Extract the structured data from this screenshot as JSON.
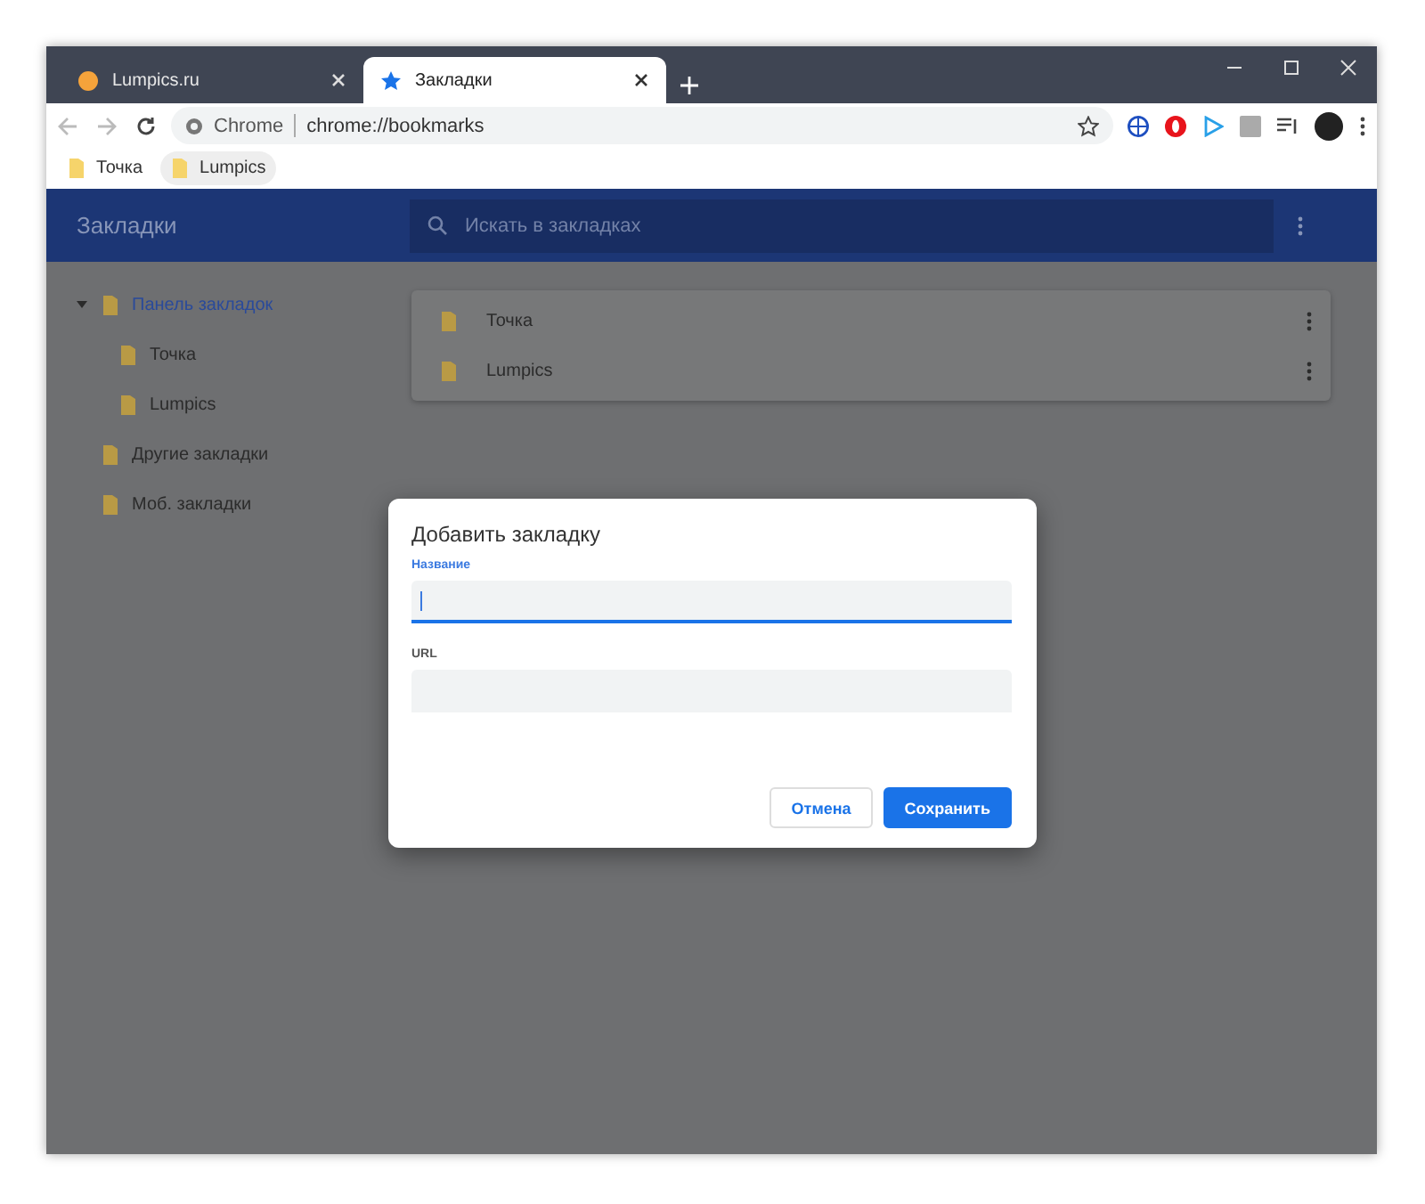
{
  "tabs": [
    {
      "title": "Lumpics.ru",
      "kind": "site",
      "selected": false
    },
    {
      "title": "Закладки",
      "kind": "bookmarks",
      "selected": true
    }
  ],
  "toolbar": {
    "back_disabled": true,
    "forward_disabled": true,
    "site_label": "Chrome",
    "url": "chrome://bookmarks"
  },
  "bookmarks_bar": [
    {
      "label": "Точка",
      "highlighted": false
    },
    {
      "label": "Lumpics",
      "highlighted": true
    }
  ],
  "app": {
    "title": "Закладки",
    "search": {
      "placeholder": "Искать в закладках"
    }
  },
  "sidebar": {
    "items": [
      {
        "label": "Панель закладок",
        "selected": true,
        "expanded": true,
        "children": [
          {
            "label": "Точка",
            "selected": false
          },
          {
            "label": "Lumpics",
            "selected": false
          }
        ]
      },
      {
        "label": "Другие закладки",
        "selected": false
      },
      {
        "label": "Моб. закладки",
        "selected": false
      }
    ]
  },
  "list": [
    {
      "label": "Точка"
    },
    {
      "label": "Lumpics"
    }
  ],
  "dialog": {
    "title": "Добавить закладку",
    "fields": [
      {
        "label": "Название",
        "focused": true
      },
      {
        "label": "URL",
        "focused": false
      }
    ],
    "buttons": [
      {
        "label": "Отмена",
        "kind": "secondary"
      },
      {
        "label": "Сохранить",
        "kind": "primary"
      }
    ]
  }
}
